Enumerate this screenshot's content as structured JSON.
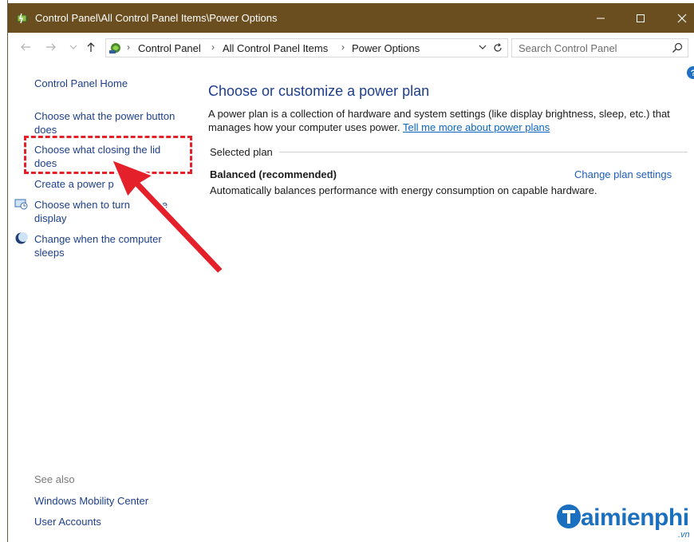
{
  "window": {
    "title": "Control Panel\\All Control Panel Items\\Power Options",
    "title_bar_color": "#6b4e1f"
  },
  "address_bar": {
    "crumbs": [
      "Control Panel",
      "All Control Panel Items",
      "Power Options"
    ],
    "search_placeholder": "Search Control Panel"
  },
  "left_nav": {
    "home": "Control Panel Home",
    "power_button_line1": "Choose what the power button",
    "power_button_line2": "does",
    "closing_lid_line1": "Choose what closing the lid",
    "closing_lid_line2": "does",
    "create_plan": "Create a power p",
    "turn_off_display_line1": "Choose when to turn",
    "turn_off_display_tail": "the",
    "turn_off_display_line2": "display",
    "sleep_line1": "Change when the computer",
    "sleep_line2": "sleeps",
    "see_also": "See also",
    "mobility_center": "Windows Mobility Center",
    "user_accounts": "User Accounts"
  },
  "main": {
    "heading": "Choose or customize a power plan",
    "description_line1": "A power plan is a collection of hardware and system settings (like display brightness, sleep, etc.) that",
    "description_line2": "manages how your computer uses power.",
    "learn_more_link": "Tell me more about power plans",
    "selected_plan_label": "Selected plan",
    "plan_name": "Balanced (recommended)",
    "plan_description": "Automatically balances performance with energy consumption on capable hardware.",
    "change_plan_link": "Change plan settings"
  },
  "annotation": {
    "highlight_color": "#e4202a"
  },
  "watermark": {
    "text": "aimienphi",
    "suffix": ".vn",
    "brand_color": "#1a6fbf"
  }
}
